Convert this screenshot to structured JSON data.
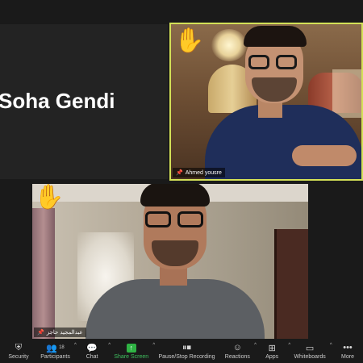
{
  "participants": {
    "soha": {
      "display_name": "Soha Gendi"
    },
    "ahmed": {
      "name_tag": "Ahmed yousre"
    },
    "abd": {
      "name_tag": "عبدالمجيد حاجز"
    }
  },
  "icons": {
    "raised_hand": "raised-hand-icon",
    "pin": "pin-icon"
  },
  "colors": {
    "active_speaker_border": "#d4e157",
    "share_green": "#2fb344",
    "hand": "#f6c23e"
  },
  "toolbar": {
    "security": "Security",
    "participants": "Participants",
    "participants_count": "18",
    "chat": "Chat",
    "share_screen": "Share Screen",
    "recording": "Pause/Stop Recording",
    "reactions": "Reactions",
    "apps": "Apps",
    "whiteboards": "Whiteboards",
    "more": "More"
  }
}
